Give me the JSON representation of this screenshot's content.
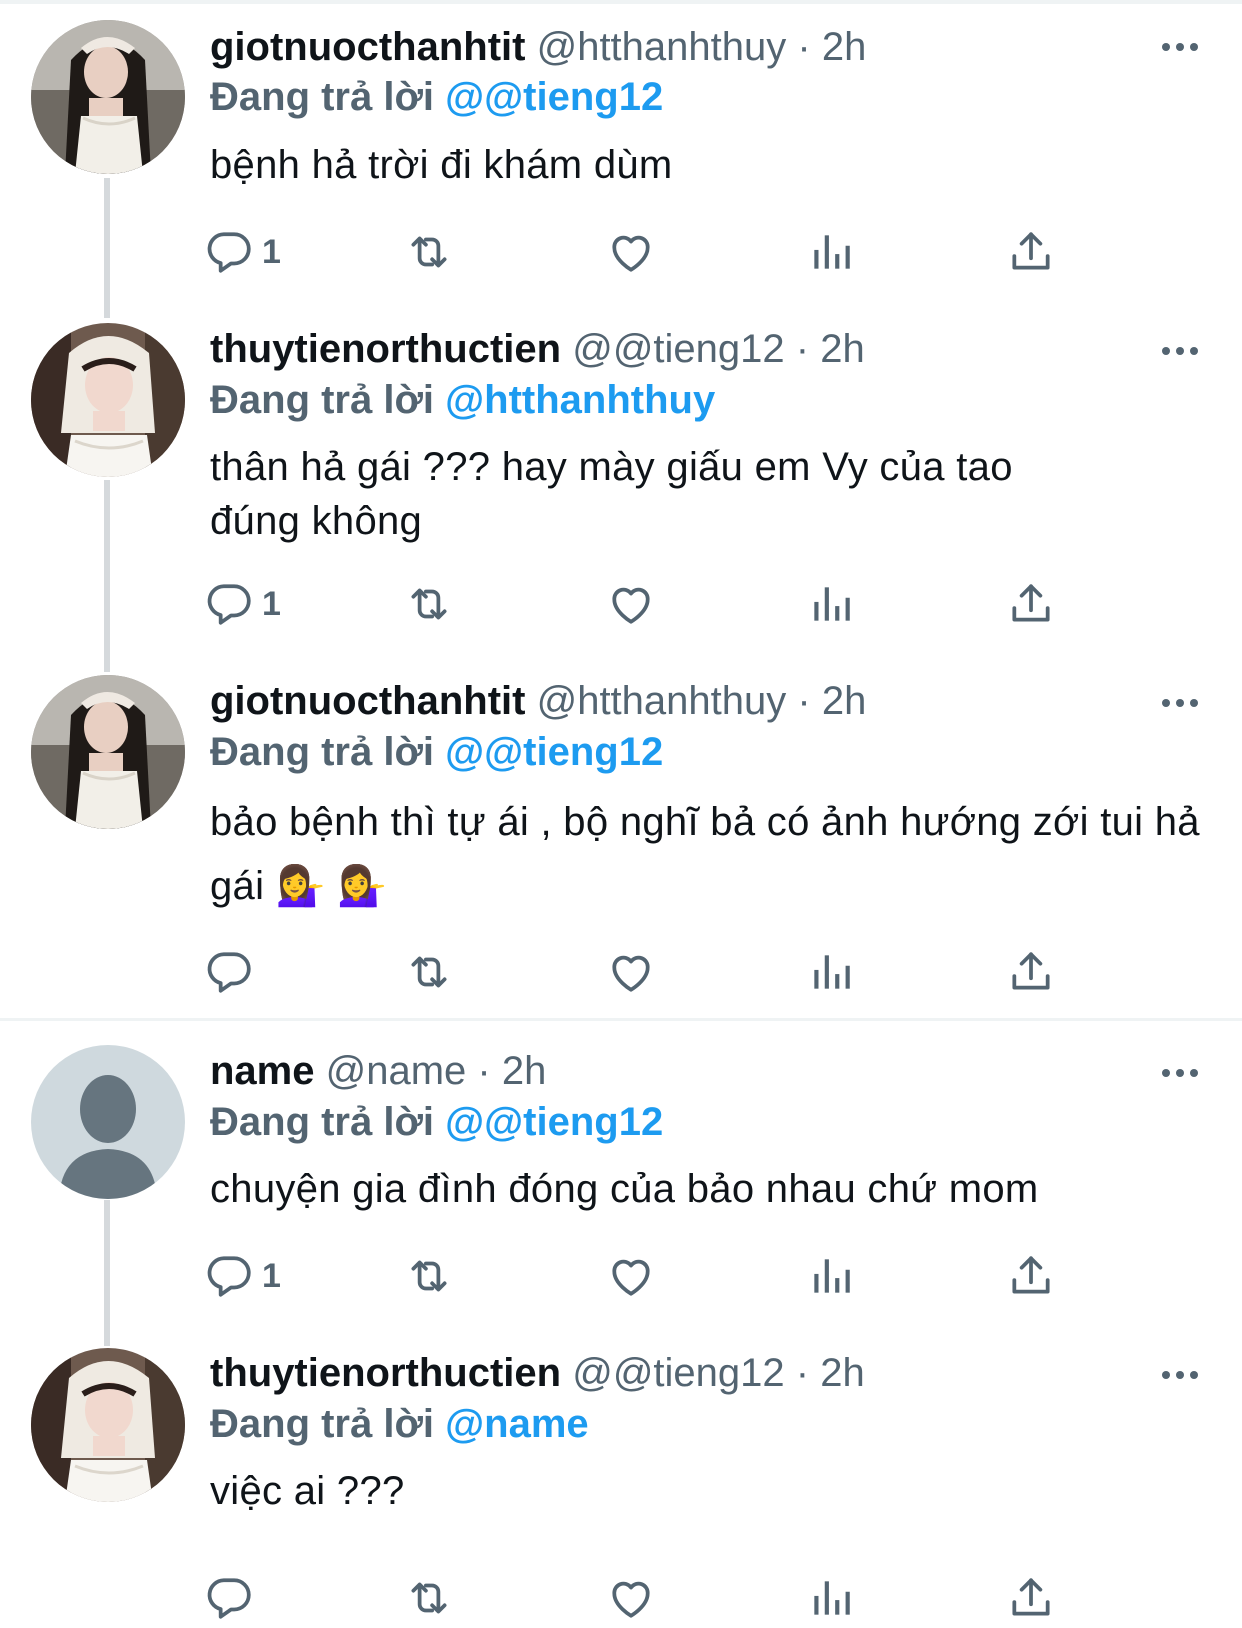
{
  "tweets": [
    {
      "display_name": "giotnuocthanhtit",
      "handle": "@htthanhthuy",
      "separator": "·",
      "time": "2h",
      "replying_label": "Đang trả lời",
      "replying_to": "@@tieng12",
      "body": "bệnh hả trời đi khám dùm",
      "reply_count": "1"
    },
    {
      "display_name": "thuytienorthuctien",
      "handle": "@@tieng12",
      "separator": "·",
      "time": "2h",
      "replying_label": "Đang trả lời",
      "replying_to": "@htthanhthuy",
      "body": "thân hả gái ??? hay mày giấu em Vy của tao đúng không",
      "reply_count": "1"
    },
    {
      "display_name": "giotnuocthanhtit",
      "handle": "@htthanhthuy",
      "separator": "·",
      "time": "2h",
      "replying_label": "Đang trả lời",
      "replying_to": "@@tieng12",
      "body": "bảo bệnh thì tự ái , bộ nghĩ bả có ảnh hướng zới tui hả gái 💁‍♀️ 💁‍♀️",
      "reply_count": ""
    },
    {
      "display_name": "name",
      "handle": "@name",
      "separator": "·",
      "time": "2h",
      "replying_label": "Đang trả lời",
      "replying_to": "@@tieng12",
      "body": "chuyện gia đình đóng của bảo nhau chứ mom",
      "reply_count": "1"
    },
    {
      "display_name": "thuytienorthuctien",
      "handle": "@@tieng12",
      "separator": "·",
      "time": "2h",
      "replying_label": "Đang trả lời",
      "replying_to": "@name",
      "body": "việc ai ???",
      "reply_count": ""
    }
  ],
  "icons": {
    "more": "more-icon",
    "reply": "reply-icon",
    "retweet": "retweet-icon",
    "like": "heart-icon",
    "views": "views-icon",
    "share": "share-icon"
  },
  "colors": {
    "accent": "#1d9bf0",
    "muted": "#536471",
    "text": "#0f1419",
    "divider": "#eff3f4",
    "thread_line": "#d5d9dc"
  }
}
